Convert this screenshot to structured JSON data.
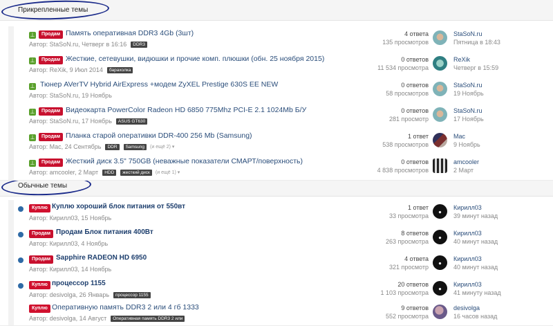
{
  "sections": {
    "pinned": "Прикрепленные темы",
    "normal": "Обычные темы"
  },
  "topics": [
    {
      "prefix": "Продам",
      "title": "Память оперативная DDR3 4Gb (3шт)",
      "author": "Автор: StaSoN.ru, Четверг в 16:16",
      "tags": [
        "DDR3"
      ],
      "more": "",
      "answers": "4 ответа",
      "views": "135 просмотров",
      "last_user": "StaSoN.ru",
      "last_time": "Пятница в 18:43",
      "avatar": "av-sea"
    },
    {
      "prefix": "Продам",
      "title": "Жесткие, сетевушки, видюшки и прочие комп. плюшки (обн. 25 ноября 2015)",
      "author": "Автор: ReXik, 9 Июл 2014",
      "tags": [
        "барахолка"
      ],
      "more": "",
      "answers": "0 ответов",
      "views": "11 534 просмотра",
      "last_user": "ReXik",
      "last_time": "Четверг в 15:59",
      "avatar": "av-rexik"
    },
    {
      "prefix": "",
      "title": "Тюнер AVerTV Hybrid AirExpress +модем ZyXEL Prestige 630S EE NEW",
      "author": "Автор: StaSoN.ru, 19 Ноябрь",
      "tags": [],
      "more": "",
      "answers": "0 ответов",
      "views": "58 просмотров",
      "last_user": "StaSoN.ru",
      "last_time": "19 Ноябрь",
      "avatar": "av-sea"
    },
    {
      "prefix": "Продам",
      "title": "Видеокарта PowerColor Radeon HD 6850 775Mhz PCI-E 2.1 1024Mb Б/У",
      "author": "Автор: StaSoN.ru, 17 Ноябрь",
      "tags": [
        "ASUS GT630"
      ],
      "more": "",
      "answers": "0 ответов",
      "views": "281 просмотр",
      "last_user": "StaSoN.ru",
      "last_time": "17 Ноябрь",
      "avatar": "av-sea"
    },
    {
      "prefix": "Продам",
      "title": "Планка старой оперативки DDR-400 256 Mb (Samsung)",
      "author": "Автор: Mac, 24 Сентябрь",
      "tags": [
        "DDR",
        "Samsung"
      ],
      "more": "(и ещё 2) ▾",
      "answers": "1 ответ",
      "views": "538 просмотров",
      "last_user": "Mac",
      "last_time": "9 Ноябрь",
      "avatar": "av-mac"
    },
    {
      "prefix": "Продам",
      "title": "Жесткий диск 3.5\" 750GB (неважные показатели СМАРТ/поверхность)",
      "author": "Автор: amcooler, 2 Март",
      "tags": [
        "HDD",
        "жесткий диск"
      ],
      "more": "(и ещё 1) ▾",
      "answers": "0 ответов",
      "views": "4 838 просмотров",
      "last_user": "amcooler",
      "last_time": "2 Март",
      "avatar": "av-amc"
    },
    {
      "prefix": "Куплю",
      "title": "Куплю хороший блок питания от 550вт",
      "author": "Автор: Кирилл03, 15 Ноябрь",
      "tags": [],
      "more": "",
      "answers": "1 ответ",
      "views": "33 просмотра",
      "last_user": "Кирилл03",
      "last_time": "39 минут назад",
      "avatar": "av-kirill"
    },
    {
      "prefix": "Продам",
      "title": "Продам Блок питания 400Вт",
      "author": "Автор: Кирилл03, 4 Ноябрь",
      "tags": [],
      "more": "",
      "answers": "8 ответов",
      "views": "263 просмотра",
      "last_user": "Кирилл03",
      "last_time": "40 минут назад",
      "avatar": "av-kirill"
    },
    {
      "prefix": "Продам",
      "title": "Sapphire RADEON HD 6950",
      "author": "Автор: Кирилл03, 14 Ноябрь",
      "tags": [],
      "more": "",
      "answers": "4 ответа",
      "views": "321 просмотр",
      "last_user": "Кирилл03",
      "last_time": "40 минут назад",
      "avatar": "av-kirill"
    },
    {
      "prefix": "Куплю",
      "title": "процессор 1155",
      "author": "Автор: desivolga, 26 Январь",
      "tags": [
        "процессор 1155"
      ],
      "more": "",
      "answers": "20 ответов",
      "views": "1 103 просмотра",
      "last_user": "Кирилл03",
      "last_time": "41 минуту назад",
      "avatar": "av-kirill"
    },
    {
      "prefix": "Куплю",
      "title": "Оперативную память DDR3 2 или 4 гб 1333",
      "author": "Автор: desivolga, 14 Август",
      "tags": [
        "Оперативная память DDR3 2 или"
      ],
      "more": "",
      "answers": "9 ответов",
      "views": "552 просмотра",
      "last_user": "desivolga",
      "last_time": "16 часов назад",
      "avatar": "av-desi"
    }
  ]
}
